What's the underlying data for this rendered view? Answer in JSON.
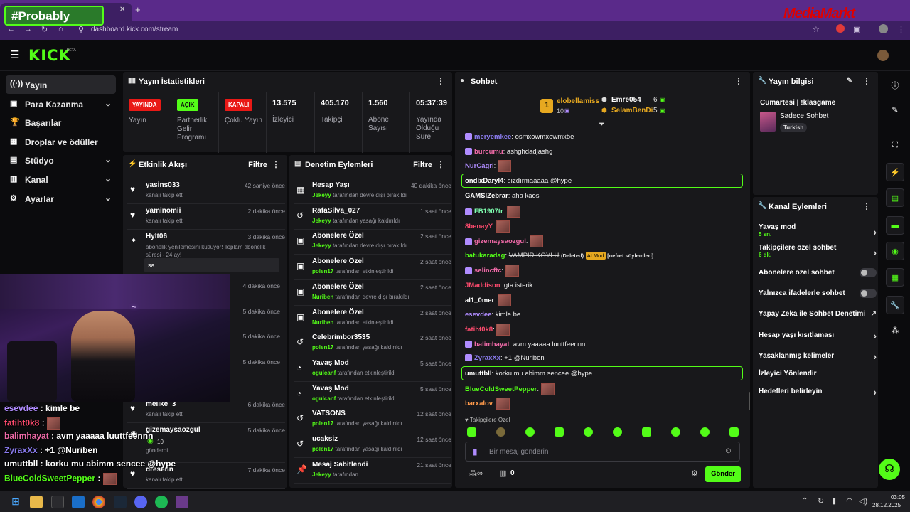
{
  "browser": {
    "tab_close": "✕",
    "tab_new": "+",
    "url": "dashboard.kick.com/stream",
    "overlay_brand": "#Probably",
    "ad_brand": "MediaMarkt"
  },
  "kick": {
    "logo": "KICK",
    "beta": "BETA"
  },
  "nav": [
    {
      "label": "Yayın",
      "icon": "broadcast-icon",
      "glyph": "((·))",
      "active": true,
      "chevron": false
    },
    {
      "label": "Para Kazanma",
      "icon": "money-icon",
      "glyph": "▣",
      "active": false,
      "chevron": true
    },
    {
      "label": "Başarılar",
      "icon": "trophy-icon",
      "glyph": "🏆",
      "active": false,
      "chevron": false
    },
    {
      "label": "Droplar ve ödüller",
      "icon": "gift-icon",
      "glyph": "▦",
      "active": false,
      "chevron": false
    },
    {
      "label": "Stüdyo",
      "icon": "studio-icon",
      "glyph": "▤",
      "active": false,
      "chevron": true
    },
    {
      "label": "Kanal",
      "icon": "channel-icon",
      "glyph": "▥",
      "active": false,
      "chevron": true
    },
    {
      "label": "Ayarlar",
      "icon": "gear-icon",
      "glyph": "⚙",
      "active": false,
      "chevron": true
    }
  ],
  "stats": {
    "title": "Yayın İstatistikleri",
    "cols": [
      {
        "value": "YAYINDA",
        "badge": true,
        "badge_color": "#e91916",
        "label": "Yayın"
      },
      {
        "value": "AÇIK",
        "badge": true,
        "badge_color": "#53fc18",
        "label": "Partnerlik Gelir Programı"
      },
      {
        "value": "KAPALI",
        "badge": true,
        "badge_color": "#e91916",
        "label": "Çoklu Yayın"
      },
      {
        "value": "13.575",
        "badge": false,
        "label": "İzleyici"
      },
      {
        "value": "405.170",
        "badge": false,
        "label": "Takipçi"
      },
      {
        "value": "1.560",
        "badge": false,
        "label": "Abone Sayısı"
      },
      {
        "value": "05:37:39",
        "badge": false,
        "label": "Yayında Olduğu Süre"
      }
    ]
  },
  "activity": {
    "title": "Etkinlik Akışı",
    "filter": "Filtre",
    "rows": [
      {
        "name": "yasins033",
        "time": "42 saniye önce",
        "sub": "kanalı takip etti",
        "icon": "heart-icon",
        "glyph": "♥"
      },
      {
        "name": "yaminomii",
        "time": "2 dakika önce",
        "sub": "kanalı takip etti",
        "icon": "heart-icon",
        "glyph": "♥"
      },
      {
        "name": "Hylt06",
        "time": "3 dakika önce",
        "sub": "abonelik yenilemesini kutluyor! Toplam abonelik süresi - 24 ay!",
        "icon": "star-icon",
        "glyph": "✦"
      }
    ],
    "resub_message": "sa",
    "hidden_times": [
      "4 dakika önce",
      "5 dakika önce",
      "5 dakika önce",
      "5 dakika önce"
    ],
    "lower_rows": [
      {
        "name": "melike_3",
        "time": "6 dakika önce",
        "sub": "kanalı takip etti",
        "icon": "heart-icon",
        "glyph": "♥"
      },
      {
        "name": "gizemaysaozgul",
        "time": "5 dakika önce",
        "sub": "gönderdi",
        "amount": "10",
        "icon": "kick-icon",
        "glyph": "◉"
      },
      {
        "name": "dresenn",
        "time": "7 dakika önce",
        "sub": "kanalı takip etti",
        "icon": "heart-icon",
        "glyph": "♥"
      }
    ]
  },
  "moderation": {
    "title": "Denetim Eylemleri",
    "filter": "Filtre",
    "rows": [
      {
        "name": "Hesap Yaşı",
        "time": "40 dakika önce",
        "actor": "Jekeyy",
        "sub": "tarafından devre dışı bırakıldı",
        "icon": "calendar-icon",
        "glyph": "▦"
      },
      {
        "name": "RafaSilva_027",
        "time": "1 saat önce",
        "actor": "Jekeyy",
        "sub": "tarafından yasağı kaldırıldı",
        "icon": "unban-icon",
        "glyph": "↺"
      },
      {
        "name": "Abonelere Özel",
        "time": "2 saat önce",
        "actor": "Jekeyy",
        "sub": "tarafından devre dışı bırakıldı",
        "icon": "gift-icon",
        "glyph": "▣"
      },
      {
        "name": "Abonelere Özel",
        "time": "2 saat önce",
        "actor": "polen17",
        "sub": "tarafından etkinleştirildi",
        "icon": "gift-icon",
        "glyph": "▣"
      },
      {
        "name": "Abonelere Özel",
        "time": "2 saat önce",
        "actor": "Nuriben",
        "sub": "tarafından devre dışı bırakıldı",
        "icon": "gift-icon",
        "glyph": "▣"
      },
      {
        "name": "Abonelere Özel",
        "time": "2 saat önce",
        "actor": "Nuriben",
        "sub": "tarafından etkinleştirildi",
        "icon": "gift-icon",
        "glyph": "▣"
      },
      {
        "name": "Celebrimbor3535",
        "time": "2 saat önce",
        "actor": "polen17",
        "sub": "tarafından yasağı kaldırıldı",
        "icon": "unban-icon",
        "glyph": "↺"
      },
      {
        "name": "Yavaş Mod",
        "time": "5 saat önce",
        "actor": "ogulcanf",
        "sub": "tarafından etkinleştirildi",
        "icon": "snail-icon",
        "glyph": "◔"
      },
      {
        "name": "Yavaş Mod",
        "time": "5 saat önce",
        "actor": "ogulcanf",
        "sub": "tarafından etkinleştirildi",
        "icon": "snail-icon",
        "glyph": "◔"
      },
      {
        "name": "VATSONS",
        "time": "12 saat önce",
        "actor": "polen17",
        "sub": "tarafından yasağı kaldırıldı",
        "icon": "unban-icon",
        "glyph": "↺"
      },
      {
        "name": "ucaksiz",
        "time": "12 saat önce",
        "actor": "polen17",
        "sub": "tarafından yasağı kaldırıldı",
        "icon": "unban-icon",
        "glyph": "↺"
      },
      {
        "name": "Mesaj Sabitlendi",
        "time": "21 saat önce",
        "actor": "Jekeyy",
        "sub": "tarafından",
        "icon": "pin-icon",
        "glyph": "📌"
      }
    ]
  },
  "chat": {
    "title": "Sohbet",
    "top_gifter": {
      "rank": "1",
      "name": "elobellamiss",
      "amount": "10"
    },
    "gifters": [
      {
        "name": "Emre054",
        "amount": "6"
      },
      {
        "name": "SelamBenDi",
        "amount": "5"
      }
    ],
    "messages": [
      {
        "user": "meryemkee",
        "color": "#8b7cf0",
        "text": "osmxowmxowmxöe",
        "emote": false,
        "hl": false
      },
      {
        "user": "burcumu",
        "color": "#f06aa8",
        "text": "ashghdadjashg",
        "emote": false,
        "hl": false
      },
      {
        "user": "NurCagri",
        "color": "#b08cff",
        "text": "",
        "emote": true,
        "hl": false
      },
      {
        "user": "ondixDaryl4",
        "color": "#fff",
        "text": "sızdırmaaaaa @hype",
        "emote": false,
        "hl": true
      },
      {
        "user": "GAMSIZebrar",
        "color": "#fff",
        "text": "aha kaos",
        "emote": false,
        "hl": false
      },
      {
        "user": "FB1907tr",
        "color": "#7fffb0",
        "text": "",
        "emote": true,
        "hl": false
      },
      {
        "user": "8benayY",
        "color": "#ff4b6e",
        "text": "",
        "emote": true,
        "hl": false
      },
      {
        "user": "gizemaysaozgul",
        "color": "#f06aa8",
        "text": "",
        "emote": true,
        "hl": false
      },
      {
        "user": "batukaradag",
        "color": "#53fc18",
        "text": "VAMPİR KÖYLÜ",
        "deleted": "(Deleted)",
        "aimod": "AI Mod",
        "reason": "[nefret söylemleri]",
        "emote": false,
        "hl": false
      },
      {
        "user": "selincftc",
        "color": "#f06aa8",
        "text": "",
        "emote": true,
        "hl": false
      },
      {
        "user": "JMaddison",
        "color": "#ff4b6e",
        "text": "gta isterik",
        "emote": false,
        "hl": false
      },
      {
        "user": "al1_0mer",
        "color": "#fff",
        "text": "",
        "emote": true,
        "hl": false
      },
      {
        "user": "esevdee",
        "color": "#b08cff",
        "text": "kimle be",
        "emote": false,
        "hl": false
      },
      {
        "user": "fatiht0k8",
        "color": "#ff4b6e",
        "text": "",
        "emote": true,
        "hl": false
      },
      {
        "user": "balimhayat",
        "color": "#f06aa8",
        "text": "avm yaaaaa luuttfeennn",
        "emote": false,
        "hl": false
      },
      {
        "user": "ZyraxXx",
        "color": "#8b7cf0",
        "text": "+1 @Nuriben",
        "emote": false,
        "hl": false
      },
      {
        "user": "umuttbll",
        "color": "#fff",
        "text": "korku mu abimm sencee @hype",
        "emote": false,
        "hl": true
      },
      {
        "user": "BlueColdSweetPepper",
        "color": "#53fc18",
        "text": "",
        "emote": true,
        "hl": false
      },
      {
        "user": "barxalov",
        "color": "#ff9a4b",
        "text": "",
        "emote": true,
        "hl": false
      }
    ],
    "followers_only": "Takipçilere Özel",
    "input_placeholder": "Bir mesaj gönderin",
    "points": "0",
    "send_label": "Gönder"
  },
  "stream_info": {
    "title": "Yayın bilgisi",
    "stream_title": "Cumartesi | !klasgame",
    "category": "Sadece Sohbet",
    "tag": "Turkish"
  },
  "channel_actions": {
    "title": "Kanal Eylemleri",
    "rows": [
      {
        "label": "Yavaş mod",
        "sub": "5 sn.",
        "kind": "arrow"
      },
      {
        "label": "Takipçilere özel sohbet",
        "sub": "6 dk.",
        "kind": "arrow"
      },
      {
        "label": "Abonelere özel sohbet",
        "sub": "",
        "kind": "toggle"
      },
      {
        "label": "Yalnızca ifadelerle sohbet",
        "sub": "",
        "kind": "toggle"
      },
      {
        "label": "Yapay Zeka ile Sohbet Denetimi",
        "sub": "",
        "kind": "external"
      },
      {
        "label": "Hesap yaşı kısıtlaması",
        "sub": "",
        "kind": "arrow"
      },
      {
        "label": "Yasaklanmış kelimeler",
        "sub": "",
        "kind": "arrow"
      },
      {
        "label": "İzleyici Yönlendir",
        "sub": "",
        "kind": "none"
      },
      {
        "label": "Hedefleri belirleyin",
        "sub": "",
        "kind": "arrow"
      }
    ]
  },
  "overlay_chat": [
    {
      "user": "esevdee",
      "color": "#b08cff",
      "text": ": kimle be",
      "emote": false
    },
    {
      "user": "fatiht0k8",
      "color": "#ff4b6e",
      "text": ":",
      "emote": true
    },
    {
      "user": "balimhayat",
      "color": "#f06aa8",
      "text": ": avm yaaaaa luuttfeennn",
      "emote": false
    },
    {
      "user": "ZyraxXx",
      "color": "#8b7cf0",
      "text": ": +1 @Nuriben",
      "emote": false
    },
    {
      "user": "umuttbll",
      "color": "#fff",
      "text": ": korku mu abimm sencee @hype",
      "emote": false
    },
    {
      "user": "BlueColdSweetPepper",
      "color": "#53fc18",
      "text": ":",
      "emote": true
    }
  ],
  "taskbar": {
    "time": "03:05",
    "date": "28.12.2025"
  }
}
